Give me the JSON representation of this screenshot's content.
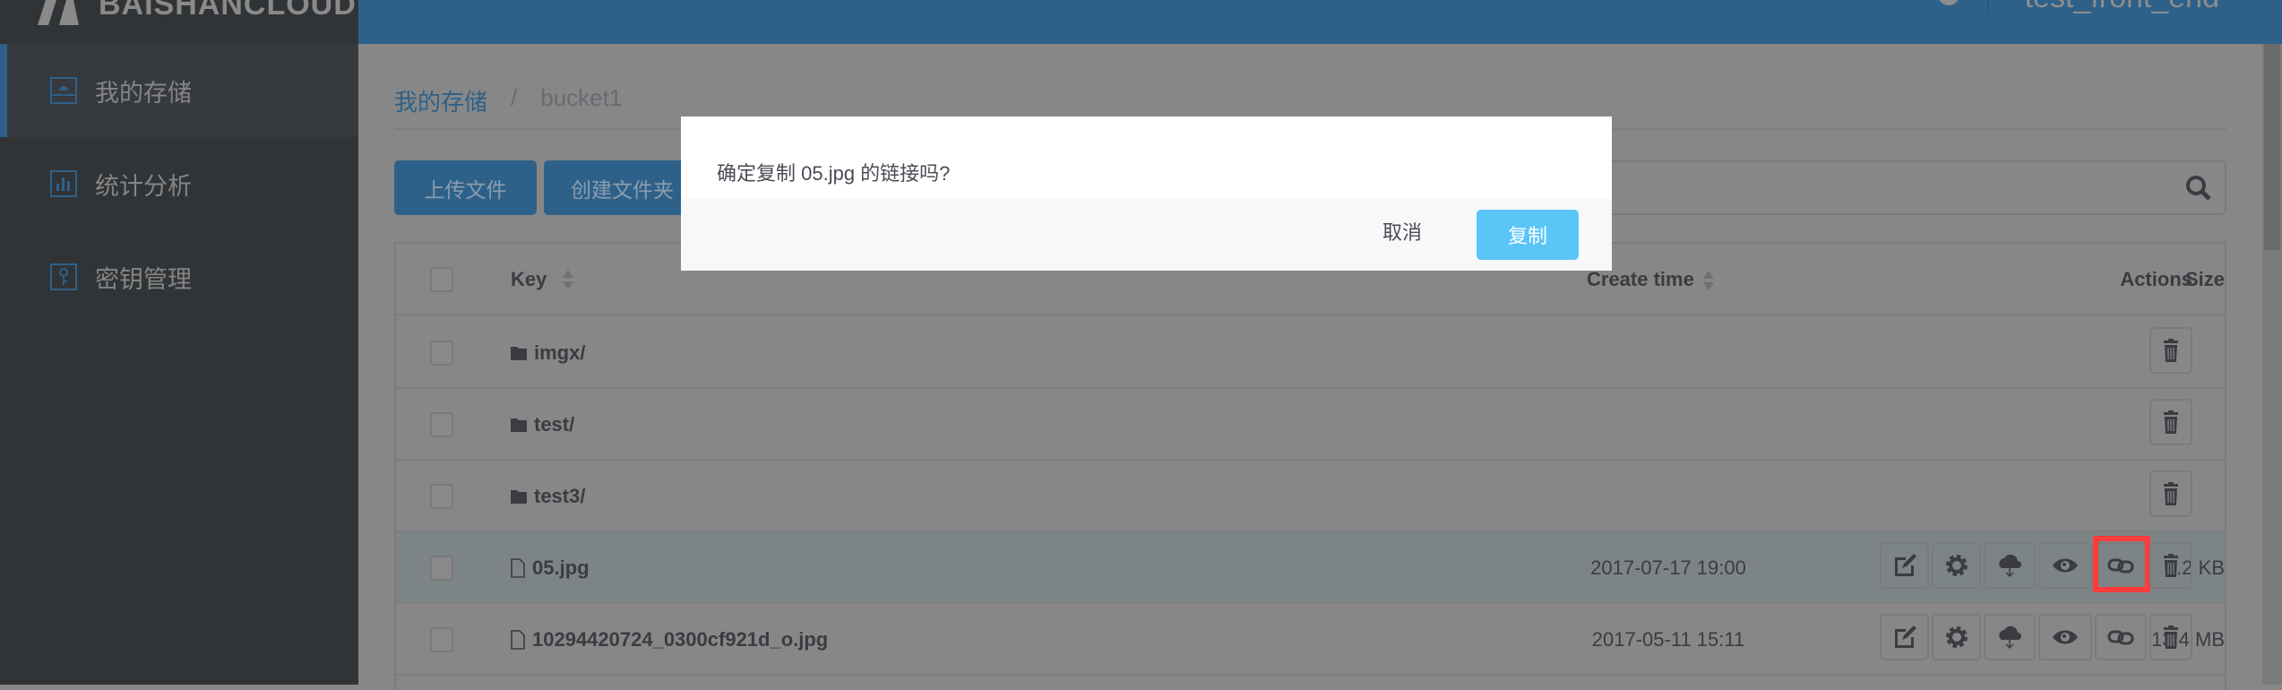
{
  "brand": {
    "logo_text": "BAISHANCLOUD"
  },
  "header": {
    "username": "test_front_end"
  },
  "sidebar": {
    "items": [
      {
        "label": "我的存储",
        "icon": "storage-icon",
        "active": true
      },
      {
        "label": "统计分析",
        "icon": "chart-icon"
      },
      {
        "label": "密钥管理",
        "icon": "key-icon"
      }
    ]
  },
  "breadcrumb": {
    "root": "我的存储",
    "sep": "/",
    "current": "bucket1"
  },
  "toolbar": {
    "upload": "上传文件",
    "create_folder": "创建文件夹"
  },
  "table": {
    "headers": {
      "key": "Key",
      "size": "Size",
      "create_time": "Create time",
      "actions": "Actions"
    },
    "rows": [
      {
        "type": "folder",
        "key": "imgx/",
        "size": "",
        "time": ""
      },
      {
        "type": "folder",
        "key": "test/",
        "size": "",
        "time": ""
      },
      {
        "type": "folder",
        "key": "test3/",
        "size": "",
        "time": ""
      },
      {
        "type": "file",
        "key": "05.jpg",
        "size": "9.2 KB",
        "time": "2017-07-17 19:00",
        "highlighted": true
      },
      {
        "type": "file",
        "key": "10294420724_0300cf921d_o.jpg",
        "size": "13.4 MB",
        "time": "2017-05-11 15:11"
      }
    ]
  },
  "dialog": {
    "message": "确定复制 05.jpg 的链接吗?",
    "cancel": "取消",
    "confirm": "复制"
  },
  "colors": {
    "header": "#2e6189",
    "confirm": "#5bc5f8",
    "highlight_box": "#ff3b3b"
  }
}
